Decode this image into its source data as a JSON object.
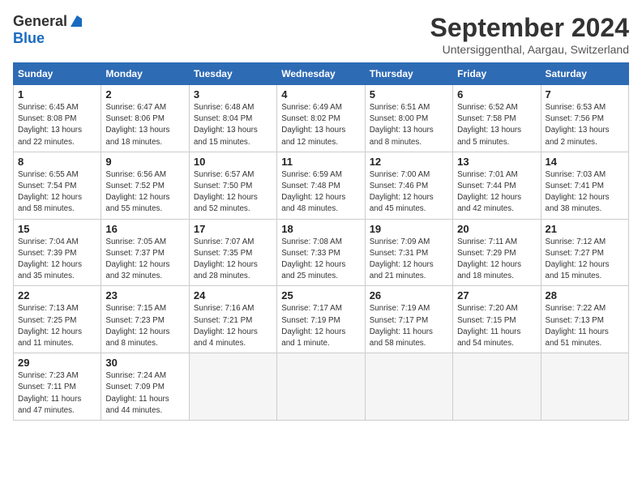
{
  "logo": {
    "line1": "General",
    "line2": "Blue"
  },
  "title": "September 2024",
  "subtitle": "Untersiggenthal, Aargau, Switzerland",
  "headers": [
    "Sunday",
    "Monday",
    "Tuesday",
    "Wednesday",
    "Thursday",
    "Friday",
    "Saturday"
  ],
  "weeks": [
    [
      {
        "day": "1",
        "detail": "Sunrise: 6:45 AM\nSunset: 8:08 PM\nDaylight: 13 hours\nand 22 minutes."
      },
      {
        "day": "2",
        "detail": "Sunrise: 6:47 AM\nSunset: 8:06 PM\nDaylight: 13 hours\nand 18 minutes."
      },
      {
        "day": "3",
        "detail": "Sunrise: 6:48 AM\nSunset: 8:04 PM\nDaylight: 13 hours\nand 15 minutes."
      },
      {
        "day": "4",
        "detail": "Sunrise: 6:49 AM\nSunset: 8:02 PM\nDaylight: 13 hours\nand 12 minutes."
      },
      {
        "day": "5",
        "detail": "Sunrise: 6:51 AM\nSunset: 8:00 PM\nDaylight: 13 hours\nand 8 minutes."
      },
      {
        "day": "6",
        "detail": "Sunrise: 6:52 AM\nSunset: 7:58 PM\nDaylight: 13 hours\nand 5 minutes."
      },
      {
        "day": "7",
        "detail": "Sunrise: 6:53 AM\nSunset: 7:56 PM\nDaylight: 13 hours\nand 2 minutes."
      }
    ],
    [
      {
        "day": "8",
        "detail": "Sunrise: 6:55 AM\nSunset: 7:54 PM\nDaylight: 12 hours\nand 58 minutes."
      },
      {
        "day": "9",
        "detail": "Sunrise: 6:56 AM\nSunset: 7:52 PM\nDaylight: 12 hours\nand 55 minutes."
      },
      {
        "day": "10",
        "detail": "Sunrise: 6:57 AM\nSunset: 7:50 PM\nDaylight: 12 hours\nand 52 minutes."
      },
      {
        "day": "11",
        "detail": "Sunrise: 6:59 AM\nSunset: 7:48 PM\nDaylight: 12 hours\nand 48 minutes."
      },
      {
        "day": "12",
        "detail": "Sunrise: 7:00 AM\nSunset: 7:46 PM\nDaylight: 12 hours\nand 45 minutes."
      },
      {
        "day": "13",
        "detail": "Sunrise: 7:01 AM\nSunset: 7:44 PM\nDaylight: 12 hours\nand 42 minutes."
      },
      {
        "day": "14",
        "detail": "Sunrise: 7:03 AM\nSunset: 7:41 PM\nDaylight: 12 hours\nand 38 minutes."
      }
    ],
    [
      {
        "day": "15",
        "detail": "Sunrise: 7:04 AM\nSunset: 7:39 PM\nDaylight: 12 hours\nand 35 minutes."
      },
      {
        "day": "16",
        "detail": "Sunrise: 7:05 AM\nSunset: 7:37 PM\nDaylight: 12 hours\nand 32 minutes."
      },
      {
        "day": "17",
        "detail": "Sunrise: 7:07 AM\nSunset: 7:35 PM\nDaylight: 12 hours\nand 28 minutes."
      },
      {
        "day": "18",
        "detail": "Sunrise: 7:08 AM\nSunset: 7:33 PM\nDaylight: 12 hours\nand 25 minutes."
      },
      {
        "day": "19",
        "detail": "Sunrise: 7:09 AM\nSunset: 7:31 PM\nDaylight: 12 hours\nand 21 minutes."
      },
      {
        "day": "20",
        "detail": "Sunrise: 7:11 AM\nSunset: 7:29 PM\nDaylight: 12 hours\nand 18 minutes."
      },
      {
        "day": "21",
        "detail": "Sunrise: 7:12 AM\nSunset: 7:27 PM\nDaylight: 12 hours\nand 15 minutes."
      }
    ],
    [
      {
        "day": "22",
        "detail": "Sunrise: 7:13 AM\nSunset: 7:25 PM\nDaylight: 12 hours\nand 11 minutes."
      },
      {
        "day": "23",
        "detail": "Sunrise: 7:15 AM\nSunset: 7:23 PM\nDaylight: 12 hours\nand 8 minutes."
      },
      {
        "day": "24",
        "detail": "Sunrise: 7:16 AM\nSunset: 7:21 PM\nDaylight: 12 hours\nand 4 minutes."
      },
      {
        "day": "25",
        "detail": "Sunrise: 7:17 AM\nSunset: 7:19 PM\nDaylight: 12 hours\nand 1 minute."
      },
      {
        "day": "26",
        "detail": "Sunrise: 7:19 AM\nSunset: 7:17 PM\nDaylight: 11 hours\nand 58 minutes."
      },
      {
        "day": "27",
        "detail": "Sunrise: 7:20 AM\nSunset: 7:15 PM\nDaylight: 11 hours\nand 54 minutes."
      },
      {
        "day": "28",
        "detail": "Sunrise: 7:22 AM\nSunset: 7:13 PM\nDaylight: 11 hours\nand 51 minutes."
      }
    ],
    [
      {
        "day": "29",
        "detail": "Sunrise: 7:23 AM\nSunset: 7:11 PM\nDaylight: 11 hours\nand 47 minutes."
      },
      {
        "day": "30",
        "detail": "Sunrise: 7:24 AM\nSunset: 7:09 PM\nDaylight: 11 hours\nand 44 minutes."
      },
      {
        "day": "",
        "detail": ""
      },
      {
        "day": "",
        "detail": ""
      },
      {
        "day": "",
        "detail": ""
      },
      {
        "day": "",
        "detail": ""
      },
      {
        "day": "",
        "detail": ""
      }
    ]
  ]
}
